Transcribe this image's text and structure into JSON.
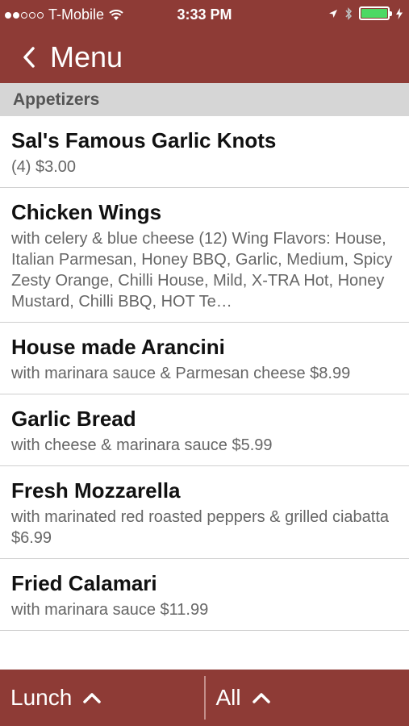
{
  "status": {
    "carrier": "T-Mobile",
    "time": "3:33 PM"
  },
  "nav": {
    "back_label": "Menu"
  },
  "section": "Appetizers",
  "items": [
    {
      "name": "Sal's Famous Garlic Knots",
      "desc": "(4) $3.00"
    },
    {
      "name": "Chicken Wings",
      "desc": "with celery & blue cheese (12) Wing Flavors: House, Italian Parmesan, Honey BBQ, Garlic, Medium, Spicy Zesty Orange, Chilli House, Mild, X-TRA Hot, Honey Mustard, Chilli BBQ, HOT Te…"
    },
    {
      "name": "House made Arancini",
      "desc": "with marinara sauce & Parmesan cheese $8.99"
    },
    {
      "name": "Garlic Bread",
      "desc": "with cheese & marinara sauce $5.99"
    },
    {
      "name": "Fresh Mozzarella",
      "desc": "with marinated red roasted peppers & grilled ciabatta $6.99"
    },
    {
      "name": "Fried Calamari",
      "desc": "with marinara sauce $11.99"
    }
  ],
  "bottom": {
    "meal_label": "Lunch",
    "filter_label": "All"
  },
  "colors": {
    "brand": "#8e3b36",
    "battery": "#4cd964"
  }
}
